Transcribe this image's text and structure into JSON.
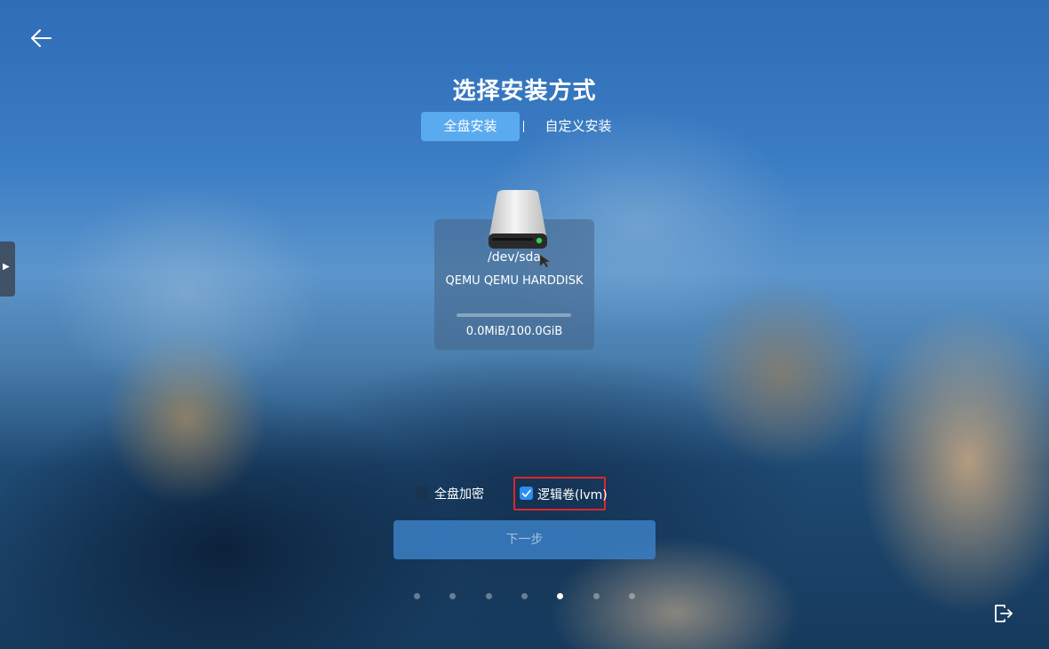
{
  "page": {
    "title": "选择安装方式"
  },
  "tabs": [
    {
      "label": "全盘安装",
      "active": true
    },
    {
      "label": "自定义安装",
      "active": false
    }
  ],
  "disk": {
    "path": "/dev/sda",
    "model": "QEMU QEMU HARDDISK",
    "size": "0.0MiB/100.0GiB",
    "used_fraction": 0
  },
  "options": {
    "encrypt": {
      "label": "全盘加密",
      "checked": false
    },
    "lvm": {
      "label": "逻辑卷(lvm)",
      "checked": true
    }
  },
  "next_button": {
    "label": "下一步",
    "enabled": false
  },
  "pager": {
    "count": 7,
    "active_index": 4
  },
  "icons": {
    "back": "arrow-left-icon",
    "disk": "hard-disk-icon",
    "exit": "exit-icon",
    "side": "play-icon"
  },
  "colors": {
    "accent": "#5aaaf0",
    "checkbox_checked": "#2b8ff0",
    "highlight_border": "#e0262a"
  }
}
